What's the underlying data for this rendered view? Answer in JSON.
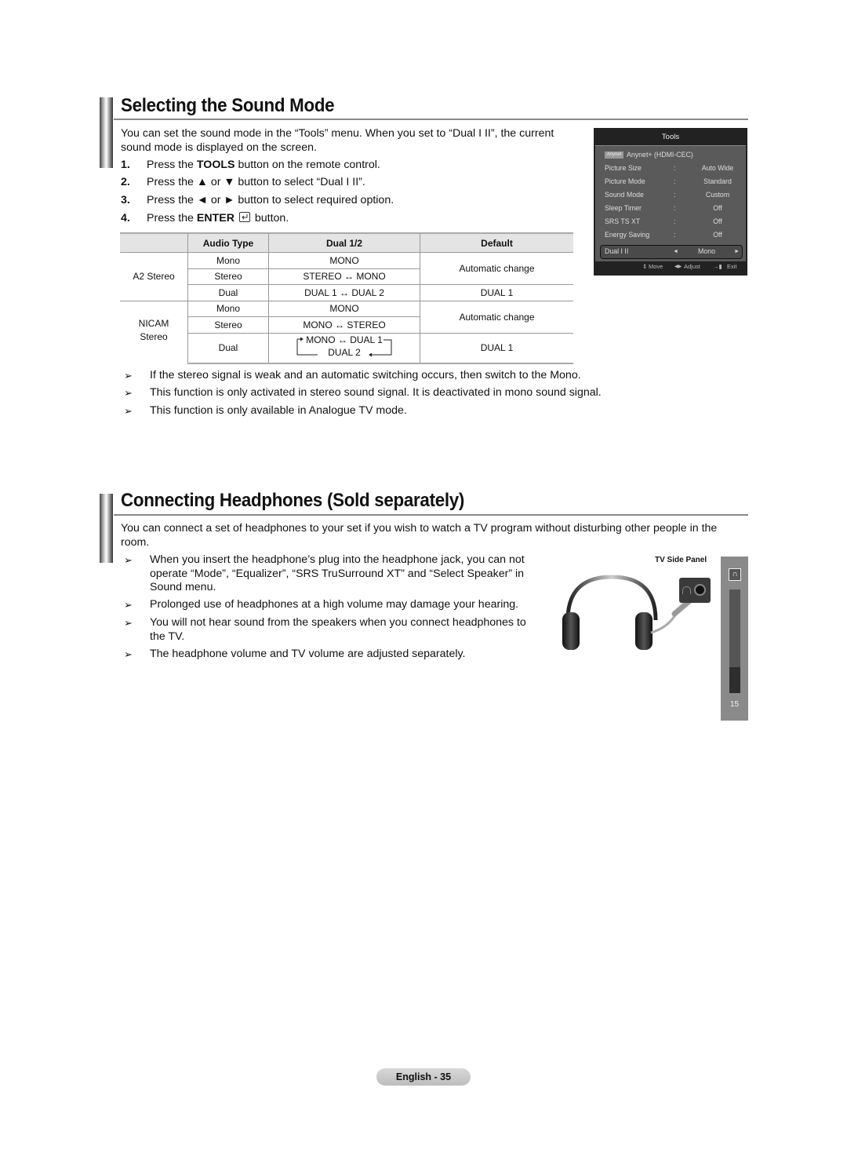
{
  "section1": {
    "title": "Selecting the Sound Mode",
    "intro": "You can set the sound mode in the “Tools” menu. When you set to “Dual I II”, the current sound mode is displayed on the screen.",
    "steps": [
      {
        "num": "1.",
        "pre": "Press the ",
        "bold": "TOOLS",
        "post": " button on the remote control."
      },
      {
        "num": "2.",
        "pre": "Press the ▲ or ▼ button to select “Dual I II”.",
        "bold": "",
        "post": ""
      },
      {
        "num": "3.",
        "pre": "Press the ◄ or ► button to select required option.",
        "bold": "",
        "post": ""
      },
      {
        "num": "4.",
        "pre": "Press the ",
        "bold": "ENTER",
        "post": " button."
      }
    ],
    "enter_icon": "enter-icon",
    "table": {
      "headers": [
        "",
        "Audio Type",
        "Dual 1/2",
        "Default"
      ],
      "groups": [
        {
          "name": "A2 Stereo",
          "rows": [
            {
              "audio_type": "Mono",
              "dual": "MONO",
              "default": "Automatic change"
            },
            {
              "audio_type": "Stereo",
              "dual": "STEREO ↔ MONO",
              "default": ""
            },
            {
              "audio_type": "Dual",
              "dual": "DUAL 1 ↔ DUAL 2",
              "default": "DUAL 1"
            }
          ]
        },
        {
          "name": "NICAM Stereo",
          "name_line1": "NICAM",
          "name_line2": "Stereo",
          "rows": [
            {
              "audio_type": "Mono",
              "dual": "MONO",
              "default": "Automatic change"
            },
            {
              "audio_type": "Stereo",
              "dual": "MONO ↔ STEREO",
              "default": ""
            },
            {
              "audio_type": "Dual",
              "dual_line1": "MONO ↔ DUAL 1",
              "dual_line2": "DUAL 2",
              "default": "DUAL 1"
            }
          ]
        }
      ]
    },
    "notes": [
      "If the stereo signal is weak and an automatic switching occurs, then switch to the Mono.",
      "This function is only activated in stereo sound signal. It is deactivated in mono sound signal.",
      "This function is only available in Analogue TV mode."
    ],
    "note_bullet": "➢"
  },
  "tools_menu": {
    "title": "Tools",
    "anynet_logo": "Anynet",
    "anynet_label": "Anynet+ (HDMI-CEC)",
    "items": [
      {
        "label": "Picture Size",
        "sep": ":",
        "value": "Auto Wide"
      },
      {
        "label": "Picture Mode",
        "sep": ":",
        "value": "Standard"
      },
      {
        "label": "Sound Mode",
        "sep": ":",
        "value": "Custom"
      },
      {
        "label": "Sleep Timer",
        "sep": ":",
        "value": "Off"
      },
      {
        "label": "SRS TS XT",
        "sep": ":",
        "value": "Off"
      },
      {
        "label": "Energy Saving",
        "sep": ":",
        "value": "Off"
      }
    ],
    "selected": {
      "label": "Dual I II",
      "value": "Mono",
      "left_arrow": "◄",
      "right_arrow": "►"
    },
    "footer": {
      "move": "Move",
      "adjust": "Adjust",
      "exit": "Exit"
    }
  },
  "section2": {
    "title": "Connecting Headphones (Sold separately)",
    "intro": "You can connect a set of headphones to your set if you wish to watch a TV program without disturbing other people in the room.",
    "notes": [
      "When you insert the headphone’s plug into the headphone jack, you can not operate “Mode”, “Equalizer”, “SRS TruSurround XT” and “Select Speaker” in Sound menu.",
      "Prolonged use of headphones at a high volume may damage your hearing.",
      "You will not hear sound from the speakers when you connect headphones to the TV.",
      "The headphone volume and TV volume are adjusted separately."
    ],
    "figure": {
      "label": "TV Side Panel",
      "volume_value": "15",
      "volume_level_fraction": 0.25
    }
  },
  "footer": {
    "page_label": "English - 35"
  }
}
